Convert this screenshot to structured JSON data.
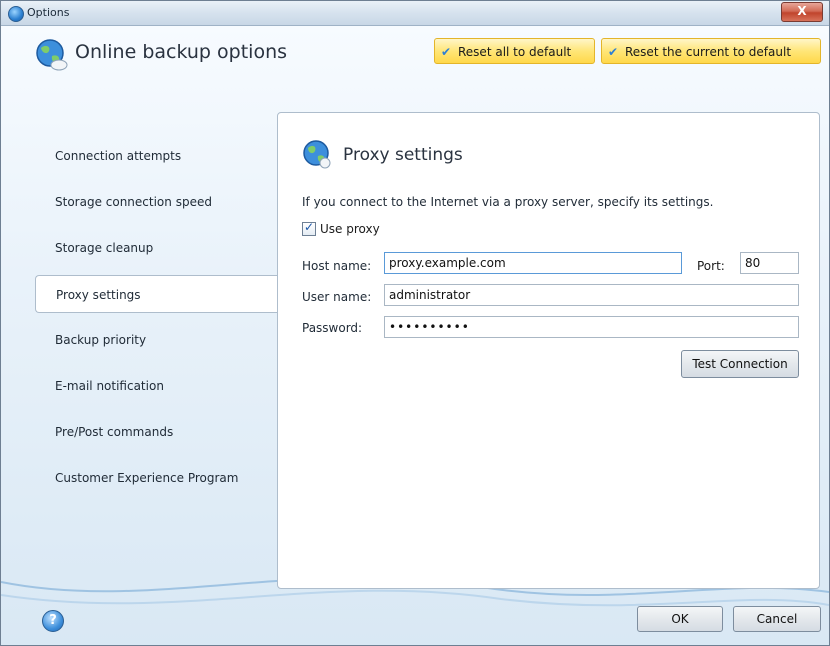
{
  "window": {
    "title": "Options",
    "close_label": "X"
  },
  "header": {
    "title": "Online backup options",
    "reset_all_label": "Reset all to default",
    "reset_current_label": "Reset the current to default"
  },
  "nav": {
    "items": [
      {
        "label": "Connection attempts",
        "active": false
      },
      {
        "label": "Storage connection speed",
        "active": false
      },
      {
        "label": "Storage cleanup",
        "active": false
      },
      {
        "label": "Proxy settings",
        "active": true
      },
      {
        "label": "Backup priority",
        "active": false
      },
      {
        "label": "E-mail notification",
        "active": false
      },
      {
        "label": "Pre/Post commands",
        "active": false
      },
      {
        "label": "Customer Experience Program",
        "active": false
      }
    ]
  },
  "panel": {
    "title": "Proxy settings",
    "description": "If you connect to the Internet via a proxy server, specify its settings.",
    "use_proxy": {
      "label": "Use proxy",
      "checked": true
    },
    "host": {
      "label": "Host name:",
      "value": "proxy.example.com"
    },
    "port": {
      "label": "Port:",
      "value": "80"
    },
    "user": {
      "label": "User name:",
      "value": "administrator"
    },
    "password": {
      "label": "Password:",
      "value": "••••••••••"
    },
    "test_button": "Test Connection"
  },
  "footer": {
    "help_icon": "?",
    "ok_label": "OK",
    "cancel_label": "Cancel"
  },
  "colors": {
    "accent": "#2e7fd3",
    "reset_button_bg": "#ffe678",
    "active_nav_bg": "#ffffff"
  }
}
